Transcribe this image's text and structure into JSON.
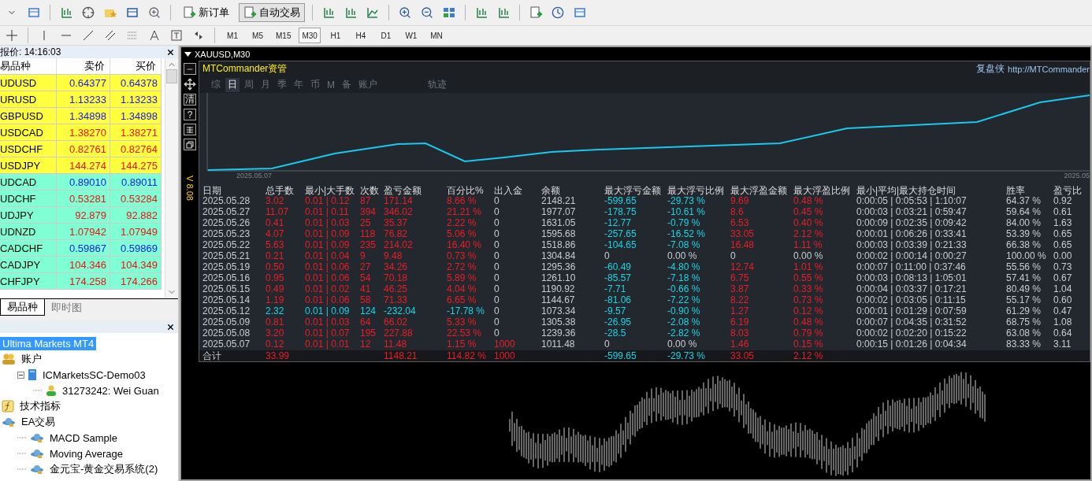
{
  "toolbar": {
    "buttons": [
      {
        "label": "新订单",
        "pressed": false
      },
      {
        "label": "自动交易",
        "pressed": true
      }
    ]
  },
  "timeframes": [
    {
      "label": "M1",
      "selected": false
    },
    {
      "label": "M5",
      "selected": false
    },
    {
      "label": "M15",
      "selected": false
    },
    {
      "label": "M30",
      "selected": true
    },
    {
      "label": "H1",
      "selected": false
    },
    {
      "label": "H4",
      "selected": false
    },
    {
      "label": "D1",
      "selected": false
    },
    {
      "label": "W1",
      "selected": false
    },
    {
      "label": "MN",
      "selected": false
    }
  ],
  "market_watch": {
    "title": "报价: 14:16:03",
    "columns": [
      "易品种",
      "卖价",
      "买价"
    ],
    "rows": [
      {
        "symbol": "UDUSD",
        "color": "#ffff40",
        "bid": {
          "text": "0.64377",
          "color": "#1818e8"
        },
        "ask": {
          "text": "0.64378",
          "color": "#1818e8"
        }
      },
      {
        "symbol": "URUSD",
        "color": "#ffff40",
        "bid": {
          "text": "1.13233",
          "color": "#1818e8"
        },
        "ask": {
          "text": "1.13233",
          "color": "#1818e8"
        }
      },
      {
        "symbol": "GBPUSD",
        "color": "#ffff40",
        "bid": {
          "text": "1.34898",
          "color": "#1818e8"
        },
        "ask": {
          "text": "1.34898",
          "color": "#1818e8"
        }
      },
      {
        "symbol": "USDCAD",
        "color": "#ffff40",
        "bid": {
          "text": "1.38270",
          "color": "#f01010"
        },
        "ask": {
          "text": "1.38271",
          "color": "#f01010"
        }
      },
      {
        "symbol": "USDCHF",
        "color": "#ffff40",
        "bid": {
          "text": "0.82761",
          "color": "#f01010"
        },
        "ask": {
          "text": "0.82764",
          "color": "#f01010"
        }
      },
      {
        "symbol": "USDJPY",
        "color": "#ffff40",
        "bid": {
          "text": "144.274",
          "color": "#f01010"
        },
        "ask": {
          "text": "144.275",
          "color": "#f01010"
        }
      },
      {
        "symbol": "UDCAD",
        "color": "#80ffd4",
        "bid": {
          "text": "0.89010",
          "color": "#1818e8"
        },
        "ask": {
          "text": "0.89011",
          "color": "#1818e8"
        }
      },
      {
        "symbol": "UDCHF",
        "color": "#80ffd4",
        "bid": {
          "text": "0.53281",
          "color": "#f01010"
        },
        "ask": {
          "text": "0.53284",
          "color": "#f01010"
        }
      },
      {
        "symbol": "UDJPY",
        "color": "#80ffd4",
        "bid": {
          "text": "92.879",
          "color": "#f01010"
        },
        "ask": {
          "text": "92.882",
          "color": "#f01010"
        }
      },
      {
        "symbol": "UDNZD",
        "color": "#80ffd4",
        "bid": {
          "text": "1.07942",
          "color": "#f01010"
        },
        "ask": {
          "text": "1.07949",
          "color": "#f01010"
        }
      },
      {
        "symbol": "CADCHF",
        "color": "#80ffd4",
        "bid": {
          "text": "0.59867",
          "color": "#1818e8"
        },
        "ask": {
          "text": "0.59869",
          "color": "#1818e8"
        }
      },
      {
        "symbol": "CADJPY",
        "color": "#80ffd4",
        "bid": {
          "text": "104.346",
          "color": "#f01010"
        },
        "ask": {
          "text": "104.349",
          "color": "#f01010"
        }
      },
      {
        "symbol": "CHFJPY",
        "color": "#80ffd4",
        "bid": {
          "text": "174.258",
          "color": "#f01010"
        },
        "ask": {
          "text": "174.266",
          "color": "#f01010"
        }
      }
    ],
    "tabs": [
      {
        "label": "易品种",
        "selected": true
      },
      {
        "label": "即时图",
        "selected": false
      }
    ]
  },
  "navigator": {
    "tree": [
      {
        "label": "Ultima Markets MT4",
        "selected": true,
        "children": [
          {
            "label": "账户",
            "kind": "accounts",
            "selected": false,
            "children": [
              {
                "label": "ICMarketsSC-Demo03",
                "kind": "server",
                "selected": false,
                "expanded": true,
                "children": [
                  {
                    "label": "31273242: Wei Guan",
                    "kind": "user",
                    "selected": false
                  }
                ]
              }
            ]
          },
          {
            "label": "技术指标",
            "kind": "indicators",
            "selected": false
          },
          {
            "label": "EA交易",
            "kind": "experts",
            "selected": false,
            "children": [
              {
                "label": "MACD Sample",
                "kind": "expert",
                "selected": false
              },
              {
                "label": "Moving Average",
                "kind": "expert",
                "selected": false
              },
              {
                "label": "金元宝-黄金交易系统(2)",
                "kind": "expert",
                "selected": false
              }
            ]
          }
        ]
      }
    ]
  },
  "chart": {
    "title": "XAUUSD,M30",
    "side_tools": [
      {
        "kind": "minus"
      },
      {
        "kind": "move"
      },
      {
        "kind": "char",
        "label": "清"
      },
      {
        "kind": "char",
        "label": "?"
      },
      {
        "kind": "grid"
      },
      {
        "kind": "restore"
      }
    ],
    "volume_label": "V 8.08"
  },
  "panel": {
    "title": "MTCommander资管",
    "brand": "复盘侠",
    "link": "http://MTCommander",
    "tabs": [
      {
        "label": "综",
        "selected": false,
        "kind": "view"
      },
      {
        "label": "日",
        "selected": true,
        "kind": "view"
      },
      {
        "label": "周",
        "selected": false,
        "kind": "view"
      },
      {
        "label": "月",
        "selected": false,
        "kind": "view"
      },
      {
        "label": "季",
        "selected": false,
        "kind": "view"
      },
      {
        "label": "年",
        "selected": false,
        "kind": "view"
      },
      {
        "label": "币",
        "selected": false,
        "kind": "view"
      },
      {
        "label": "M",
        "selected": false,
        "kind": "view"
      },
      {
        "label": "备",
        "selected": false,
        "kind": "view"
      },
      {
        "label": "账户",
        "selected": false,
        "kind": "view"
      },
      {
        "label": "轨迹",
        "selected": false,
        "kind": "trace"
      }
    ],
    "curve": {
      "start_label": "2025.05.07",
      "end_label": "2025.05"
    },
    "columns": [
      "日期",
      "总手数",
      "最小|大手数",
      "次数",
      "盈亏金额",
      "百分比%",
      "出入金",
      "余额",
      "最大浮亏金额",
      "最大浮亏比例",
      "最大浮盈金额",
      "最大浮盈比例",
      "最小|平均|最大持仓时间",
      "胜率",
      "盈亏比"
    ],
    "rows": [
      [
        "2025.05.28",
        {
          "text": "3.02",
          "color": "#ee1c24"
        },
        {
          "text": "0.01 | 0.12",
          "color": "#ee1c24"
        },
        {
          "text": "87",
          "color": "#ee1c24"
        },
        {
          "text": "171.14",
          "color": "#ee1c24"
        },
        {
          "text": "8.66 %",
          "color": "#ee1c24"
        },
        "0",
        "2148.21",
        {
          "text": "-599.65",
          "color": "#1ad4e6"
        },
        {
          "text": "-29.73 %",
          "color": "#1ad4e6"
        },
        {
          "text": "9.69",
          "color": "#ee1c24"
        },
        {
          "text": "0.48 %",
          "color": "#ee1c24"
        },
        "0:00:05 | 0:05:53 | 1:10:07",
        "64.37 %",
        "0.92"
      ],
      [
        "2025.05.27",
        {
          "text": "11.07",
          "color": "#ee1c24"
        },
        {
          "text": "0.01 | 0.11",
          "color": "#ee1c24"
        },
        {
          "text": "394",
          "color": "#ee1c24"
        },
        {
          "text": "346.02",
          "color": "#ee1c24"
        },
        {
          "text": "21.21 %",
          "color": "#ee1c24"
        },
        "0",
        "1977.07",
        {
          "text": "-178.75",
          "color": "#1ad4e6"
        },
        {
          "text": "-10.61 %",
          "color": "#1ad4e6"
        },
        {
          "text": "8.6",
          "color": "#ee1c24"
        },
        {
          "text": "0.45 %",
          "color": "#ee1c24"
        },
        "0:00:03 | 0:03:21 | 0:59:47",
        "59.64 %",
        "0.61"
      ],
      [
        "2025.05.26",
        {
          "text": "0.41",
          "color": "#ee1c24"
        },
        {
          "text": "0.01 | 0.03",
          "color": "#ee1c24"
        },
        {
          "text": "25",
          "color": "#ee1c24"
        },
        {
          "text": "35.37",
          "color": "#ee1c24"
        },
        {
          "text": "2.22 %",
          "color": "#ee1c24"
        },
        "0",
        "1631.05",
        {
          "text": "-12.77",
          "color": "#1ad4e6"
        },
        {
          "text": "-0.79 %",
          "color": "#1ad4e6"
        },
        {
          "text": "6.53",
          "color": "#ee1c24"
        },
        {
          "text": "0.40 %",
          "color": "#ee1c24"
        },
        "0:00:09 | 0:02:35 | 0:09:42",
        "84.00 %",
        "1.63"
      ],
      [
        "2025.05.23",
        {
          "text": "4.07",
          "color": "#ee1c24"
        },
        {
          "text": "0.01 | 0.09",
          "color": "#ee1c24"
        },
        {
          "text": "118",
          "color": "#ee1c24"
        },
        {
          "text": "76.82",
          "color": "#ee1c24"
        },
        {
          "text": "5.06 %",
          "color": "#ee1c24"
        },
        "0",
        "1595.68",
        {
          "text": "-257.65",
          "color": "#1ad4e6"
        },
        {
          "text": "-16.52 %",
          "color": "#1ad4e6"
        },
        {
          "text": "33.05",
          "color": "#ee1c24"
        },
        {
          "text": "2.12 %",
          "color": "#ee1c24"
        },
        "0:00:01 | 0:06:26 | 0:33:41",
        "53.39 %",
        "0.65"
      ],
      [
        "2025.05.22",
        {
          "text": "5.63",
          "color": "#ee1c24"
        },
        {
          "text": "0.01 | 0.09",
          "color": "#ee1c24"
        },
        {
          "text": "235",
          "color": "#ee1c24"
        },
        {
          "text": "214.02",
          "color": "#ee1c24"
        },
        {
          "text": "16.40 %",
          "color": "#ee1c24"
        },
        "0",
        "1518.86",
        {
          "text": "-104.65",
          "color": "#1ad4e6"
        },
        {
          "text": "-7.08 %",
          "color": "#1ad4e6"
        },
        {
          "text": "16.48",
          "color": "#ee1c24"
        },
        {
          "text": "1.11 %",
          "color": "#ee1c24"
        },
        "0:00:03 | 0:03:39 | 0:21:33",
        "66.38 %",
        "0.65"
      ],
      [
        "2025.05.21",
        {
          "text": "0.21",
          "color": "#ee1c24"
        },
        {
          "text": "0.01 | 0.04",
          "color": "#ee1c24"
        },
        {
          "text": "9",
          "color": "#ee1c24"
        },
        {
          "text": "9.48",
          "color": "#ee1c24"
        },
        {
          "text": "0.73 %",
          "color": "#ee1c24"
        },
        "0",
        "1304.84",
        "0",
        "0.00 %",
        "0",
        "0.00 %",
        "0:00:02 | 0:00:14 | 0:00:27",
        "100.00 %",
        "0.00"
      ],
      [
        "2025.05.19",
        {
          "text": "0.50",
          "color": "#ee1c24"
        },
        {
          "text": "0.01 | 0.06",
          "color": "#ee1c24"
        },
        {
          "text": "27",
          "color": "#ee1c24"
        },
        {
          "text": "34.26",
          "color": "#ee1c24"
        },
        {
          "text": "2.72 %",
          "color": "#ee1c24"
        },
        "0",
        "1295.36",
        {
          "text": "-60.49",
          "color": "#1ad4e6"
        },
        {
          "text": "-4.80 %",
          "color": "#1ad4e6"
        },
        {
          "text": "12.74",
          "color": "#ee1c24"
        },
        {
          "text": "1.01 %",
          "color": "#ee1c24"
        },
        "0:00:07 | 0:11:00 | 0:37:46",
        "55.56 %",
        "0.73"
      ],
      [
        "2025.05.16",
        {
          "text": "0.95",
          "color": "#ee1c24"
        },
        {
          "text": "0.01 | 0.06",
          "color": "#ee1c24"
        },
        {
          "text": "54",
          "color": "#ee1c24"
        },
        {
          "text": "70.18",
          "color": "#ee1c24"
        },
        {
          "text": "5.89 %",
          "color": "#ee1c24"
        },
        "0",
        "1261.10",
        {
          "text": "-85.57",
          "color": "#1ad4e6"
        },
        {
          "text": "-7.18 %",
          "color": "#1ad4e6"
        },
        {
          "text": "6.75",
          "color": "#ee1c24"
        },
        {
          "text": "0.55 %",
          "color": "#ee1c24"
        },
        "0:00:03 | 0:08:13 | 1:05:01",
        "57.41 %",
        "0.67"
      ],
      [
        "2025.05.15",
        {
          "text": "0.49",
          "color": "#ee1c24"
        },
        {
          "text": "0.01 | 0.02",
          "color": "#ee1c24"
        },
        {
          "text": "41",
          "color": "#ee1c24"
        },
        {
          "text": "46.25",
          "color": "#ee1c24"
        },
        {
          "text": "4.04 %",
          "color": "#ee1c24"
        },
        "0",
        "1190.92",
        {
          "text": "-7.71",
          "color": "#1ad4e6"
        },
        {
          "text": "-0.66 %",
          "color": "#1ad4e6"
        },
        {
          "text": "3.87",
          "color": "#ee1c24"
        },
        {
          "text": "0.33 %",
          "color": "#ee1c24"
        },
        "0:00:04 | 0:03:37 | 0:17:21",
        "80.49 %",
        "1.04"
      ],
      [
        "2025.05.14",
        {
          "text": "1.19",
          "color": "#ee1c24"
        },
        {
          "text": "0.01 | 0.06",
          "color": "#ee1c24"
        },
        {
          "text": "58",
          "color": "#ee1c24"
        },
        {
          "text": "71.33",
          "color": "#ee1c24"
        },
        {
          "text": "6.65 %",
          "color": "#ee1c24"
        },
        "0",
        "1144.67",
        {
          "text": "-81.06",
          "color": "#1ad4e6"
        },
        {
          "text": "-7.22 %",
          "color": "#1ad4e6"
        },
        {
          "text": "8.22",
          "color": "#ee1c24"
        },
        {
          "text": "0.73 %",
          "color": "#ee1c24"
        },
        "0:00:02 | 0:03:05 | 0:11:15",
        "55.17 %",
        "0.60"
      ],
      [
        "2025.05.12",
        {
          "text": "2.32",
          "color": "#1ad4e6"
        },
        {
          "text": "0.01 | 0.09",
          "color": "#1ad4e6"
        },
        {
          "text": "124",
          "color": "#1ad4e6"
        },
        {
          "text": "-232.04",
          "color": "#1ad4e6"
        },
        {
          "text": "-17.78 %",
          "color": "#1ad4e6"
        },
        "0",
        "1073.34",
        {
          "text": "-9.57",
          "color": "#1ad4e6"
        },
        {
          "text": "-0.90 %",
          "color": "#1ad4e6"
        },
        {
          "text": "1.27",
          "color": "#ee1c24"
        },
        {
          "text": "0.12 %",
          "color": "#ee1c24"
        },
        "0:00:01 | 0:01:29 | 0:07:59",
        "61.29 %",
        "0.47"
      ],
      [
        "2025.05.09",
        {
          "text": "0.81",
          "color": "#ee1c24"
        },
        {
          "text": "0.01 | 0.03",
          "color": "#ee1c24"
        },
        {
          "text": "64",
          "color": "#ee1c24"
        },
        {
          "text": "66.02",
          "color": "#ee1c24"
        },
        {
          "text": "5.33 %",
          "color": "#ee1c24"
        },
        "0",
        "1305.38",
        {
          "text": "-26.95",
          "color": "#1ad4e6"
        },
        {
          "text": "-2.08 %",
          "color": "#1ad4e6"
        },
        {
          "text": "6.19",
          "color": "#ee1c24"
        },
        {
          "text": "0.48 %",
          "color": "#ee1c24"
        },
        "0:00:07 | 0:04:35 | 0:31:52",
        "68.75 %",
        "1.08"
      ],
      [
        "2025.05.08",
        {
          "text": "3.20",
          "color": "#ee1c24"
        },
        {
          "text": "0.01 | 0.07",
          "color": "#ee1c24"
        },
        {
          "text": "195",
          "color": "#ee1c24"
        },
        {
          "text": "227.88",
          "color": "#ee1c24"
        },
        {
          "text": "22.53 %",
          "color": "#ee1c24"
        },
        "0",
        "1239.36",
        {
          "text": "-28.5",
          "color": "#1ad4e6"
        },
        {
          "text": "-2.82 %",
          "color": "#1ad4e6"
        },
        {
          "text": "8.03",
          "color": "#ee1c24"
        },
        {
          "text": "0.79 %",
          "color": "#ee1c24"
        },
        "0:00:02 | 0:02:20 | 0:15:22",
        "63.08 %",
        "0.64"
      ],
      [
        "2025.05.07",
        {
          "text": "0.12",
          "color": "#ee1c24"
        },
        {
          "text": "0.01 | 0.01",
          "color": "#ee1c24"
        },
        {
          "text": "12",
          "color": "#ee1c24"
        },
        {
          "text": "11.48",
          "color": "#ee1c24"
        },
        {
          "text": "1.15 %",
          "color": "#ee1c24"
        },
        {
          "text": "1000",
          "color": "#ee1c24"
        },
        "1011.48",
        "0",
        "0.00 %",
        {
          "text": "1.46",
          "color": "#ee1c24"
        },
        {
          "text": "0.15 %",
          "color": "#ee1c24"
        },
        "0:00:15 | 0:01:26 | 0:04:34",
        "83.33 %",
        "3.11"
      ]
    ],
    "total": {
      "date": "合计",
      "lots": {
        "text": "33.99",
        "color": "#ee1c24"
      },
      "pnl": {
        "text": "1148.21",
        "color": "#ee1c24"
      },
      "pct": {
        "text": "114.82 %",
        "color": "#ee1c24"
      },
      "deposit": {
        "text": "1000",
        "color": "#ee1c24"
      },
      "max_dd": {
        "text": "-599.65",
        "color": "#1ad4e6"
      },
      "max_dd_pct": {
        "text": "-29.73 %",
        "color": "#1ad4e6"
      },
      "max_fp": {
        "text": "33.05",
        "color": "#ee1c24"
      },
      "max_fp_pct": {
        "text": "2.12 %",
        "color": "#ee1c24"
      }
    }
  }
}
